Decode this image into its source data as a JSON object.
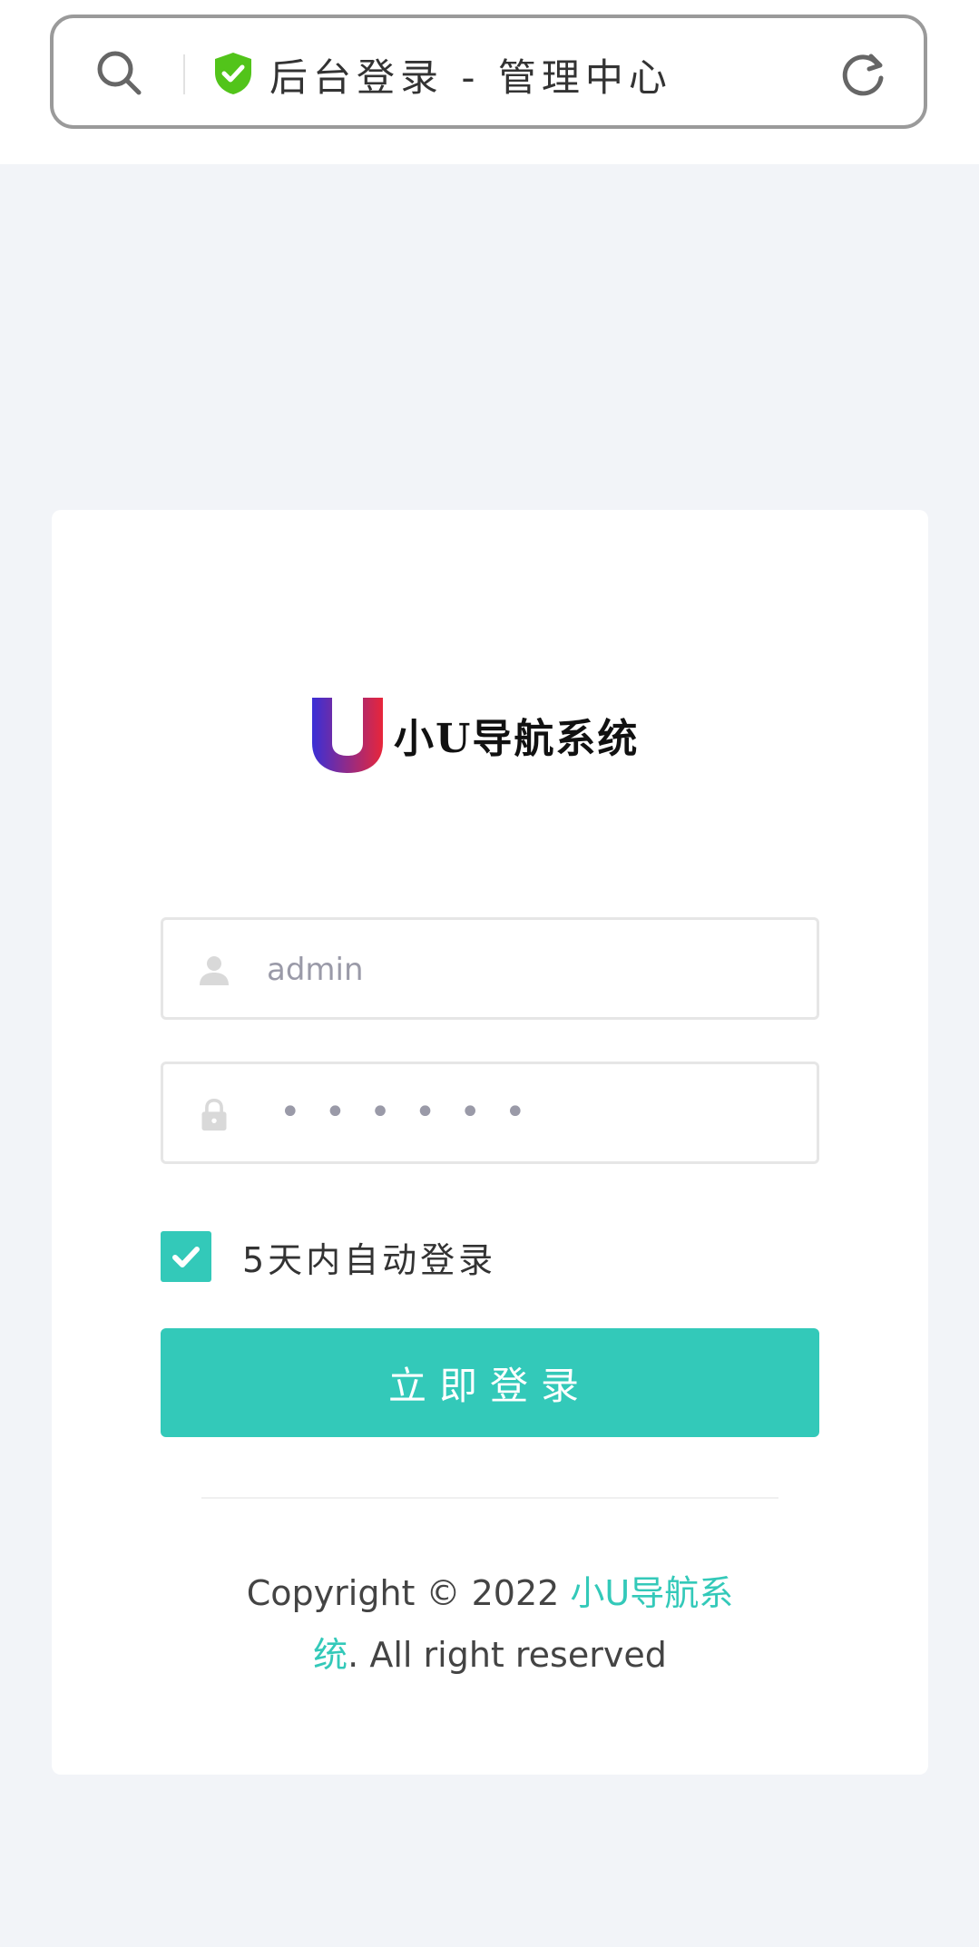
{
  "browser": {
    "page_title": "后台登录 - 管理中心",
    "icons": [
      "search-icon",
      "shield-check-icon",
      "reload-icon"
    ],
    "shield_color": "#52c41a"
  },
  "login": {
    "logo_text": "小U导航系统",
    "username_value": "admin",
    "password_mask": "••••••",
    "remember_checked": true,
    "remember_label": "5天内自动登录",
    "submit_label": "立即登录"
  },
  "footer": {
    "copyright_prefix": "Copyright © 2022 ",
    "link_text": "小U导航系统",
    "copyright_suffix": ". All right reserved"
  },
  "colors": {
    "accent": "#33c9b9",
    "background": "#f2f4f8"
  }
}
